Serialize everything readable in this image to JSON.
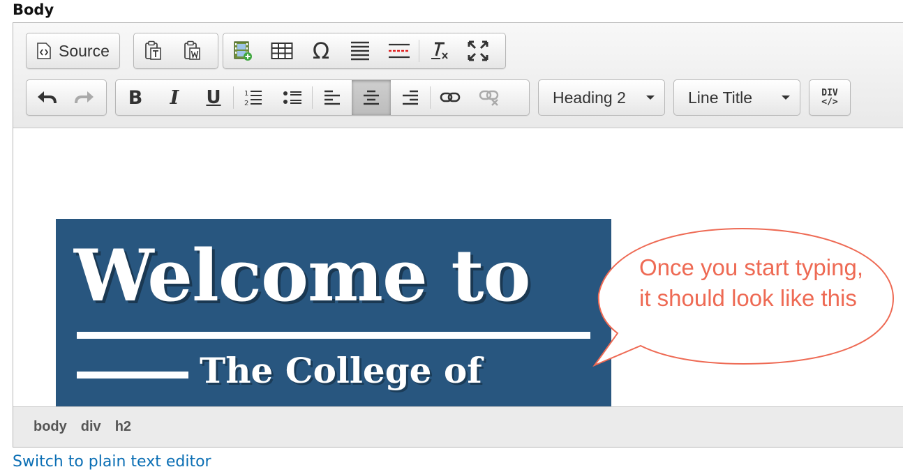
{
  "field": {
    "label": "Body"
  },
  "toolbar": {
    "source_label": "Source",
    "format_select": "Heading 2",
    "style_select": "Line Title",
    "div_label_top": "DIV",
    "div_label_bottom": "</>"
  },
  "content": {
    "banner_title": "Welcome to",
    "banner_subtitle": "The College of",
    "banner_color": "#28567f"
  },
  "annotation": {
    "callout_text": "Once you start typing, it should look like this",
    "color": "#ee6a54"
  },
  "path": [
    "body",
    "div",
    "h2"
  ],
  "switch_link": "Switch to plain text editor"
}
